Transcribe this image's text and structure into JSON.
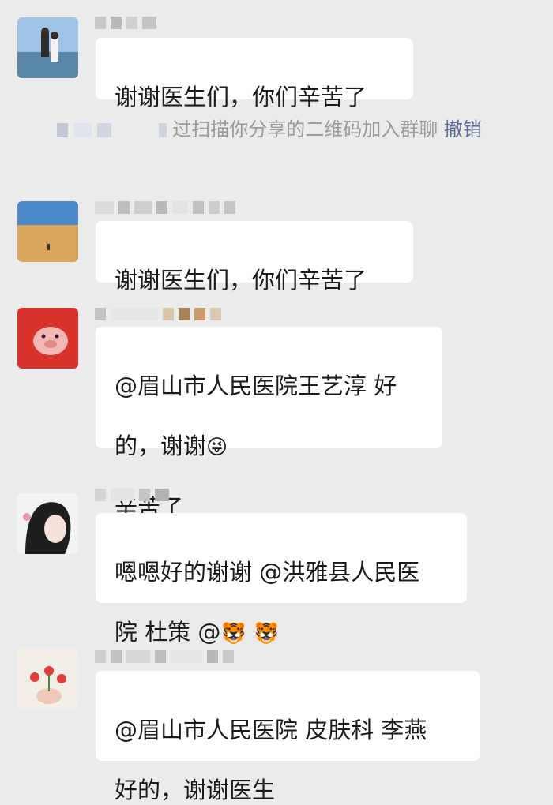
{
  "messages": [
    {
      "text": "谢谢医生们，你们辛苦了"
    },
    {
      "text": "谢谢医生们，你们辛苦了"
    },
    {
      "line1": "@眉山市人民医院王艺淳 好",
      "line2": "的，谢谢",
      "emoji": "😜",
      "line3": "辛苦了"
    },
    {
      "line1": "嗯嗯好的谢谢 @洪雅县人民医",
      "line2": "院 杜策 @",
      "emoji1": "🐯",
      "emoji2": "🐯"
    },
    {
      "line1": "@眉山市人民医院 皮肤科 李燕",
      "line2": "好的，谢谢医生"
    }
  ],
  "system_notice": {
    "text": "过扫描你分享的二维码加入群聊",
    "action": "撤销"
  },
  "colors": {
    "background": "#ebebeb",
    "bubble": "#ffffff",
    "link": "#5b6b8f"
  }
}
